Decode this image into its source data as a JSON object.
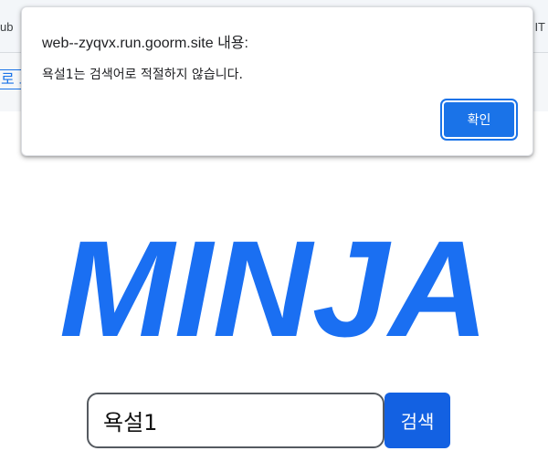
{
  "bookmarks": {
    "left_fragment": "ub",
    "right_fragment": "IT"
  },
  "page": {
    "link_fragment": "로 그"
  },
  "dialog": {
    "title": "web--zyqvx.run.goorm.site 내용:",
    "message": "욕설1는 검색어로 적절하지 않습니다.",
    "ok_label": "확인"
  },
  "logo": {
    "text": "MINJA",
    "color": "#1a6ff2"
  },
  "search": {
    "value": "욕설1",
    "button_label": "검색"
  }
}
